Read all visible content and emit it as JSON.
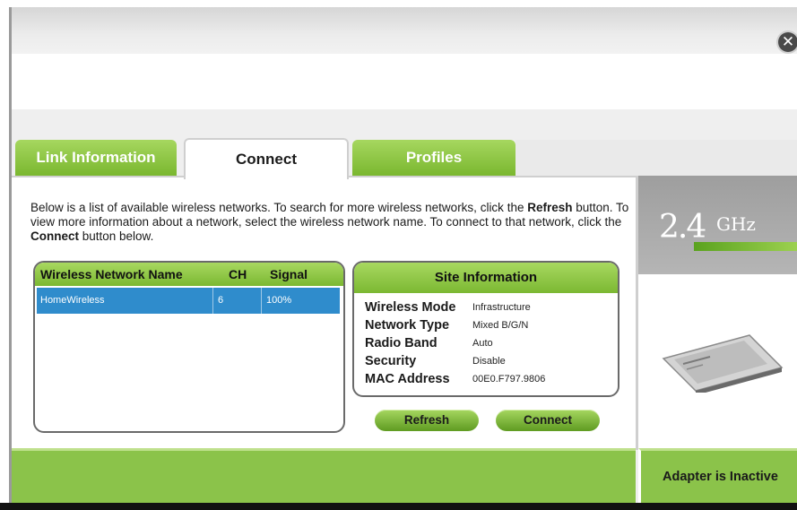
{
  "window": {
    "close_icon": "close-circle-icon"
  },
  "tabs": [
    {
      "label": "Link Information",
      "active": false
    },
    {
      "label": "Connect",
      "active": true
    },
    {
      "label": "Profiles",
      "active": false
    }
  ],
  "intro": {
    "part1": "Below is a list of available wireless networks. To search for more wireless networks, click the ",
    "refresh_word": "Refresh",
    "part2": " button. To view more information about a network, select the wireless network name. To connect to that network, click the ",
    "connect_word": "Connect",
    "part3": " button below."
  },
  "network_list": {
    "columns": [
      "Wireless Network Name",
      "CH",
      "Signal"
    ],
    "rows": [
      {
        "name": "HomeWireless",
        "ch": "6",
        "signal": "100%",
        "selected": true
      }
    ]
  },
  "site_info": {
    "title": "Site Information",
    "fields": [
      {
        "label": "Wireless Mode",
        "value": "Infrastructure"
      },
      {
        "label": "Network Type",
        "value": "Mixed B/G/N"
      },
      {
        "label": "Radio Band",
        "value": "Auto"
      },
      {
        "label": "Security",
        "value": "Disable"
      },
      {
        "label": "MAC Address",
        "value": "00E0.F797.9806"
      }
    ]
  },
  "buttons": {
    "refresh": "Refresh",
    "connect": "Connect"
  },
  "side": {
    "band_number": "2.4",
    "band_unit": "GHz",
    "status": "Adapter is Inactive"
  },
  "colors": {
    "accent_green": "#8bc34a",
    "selection_blue": "#2f8ccc"
  }
}
